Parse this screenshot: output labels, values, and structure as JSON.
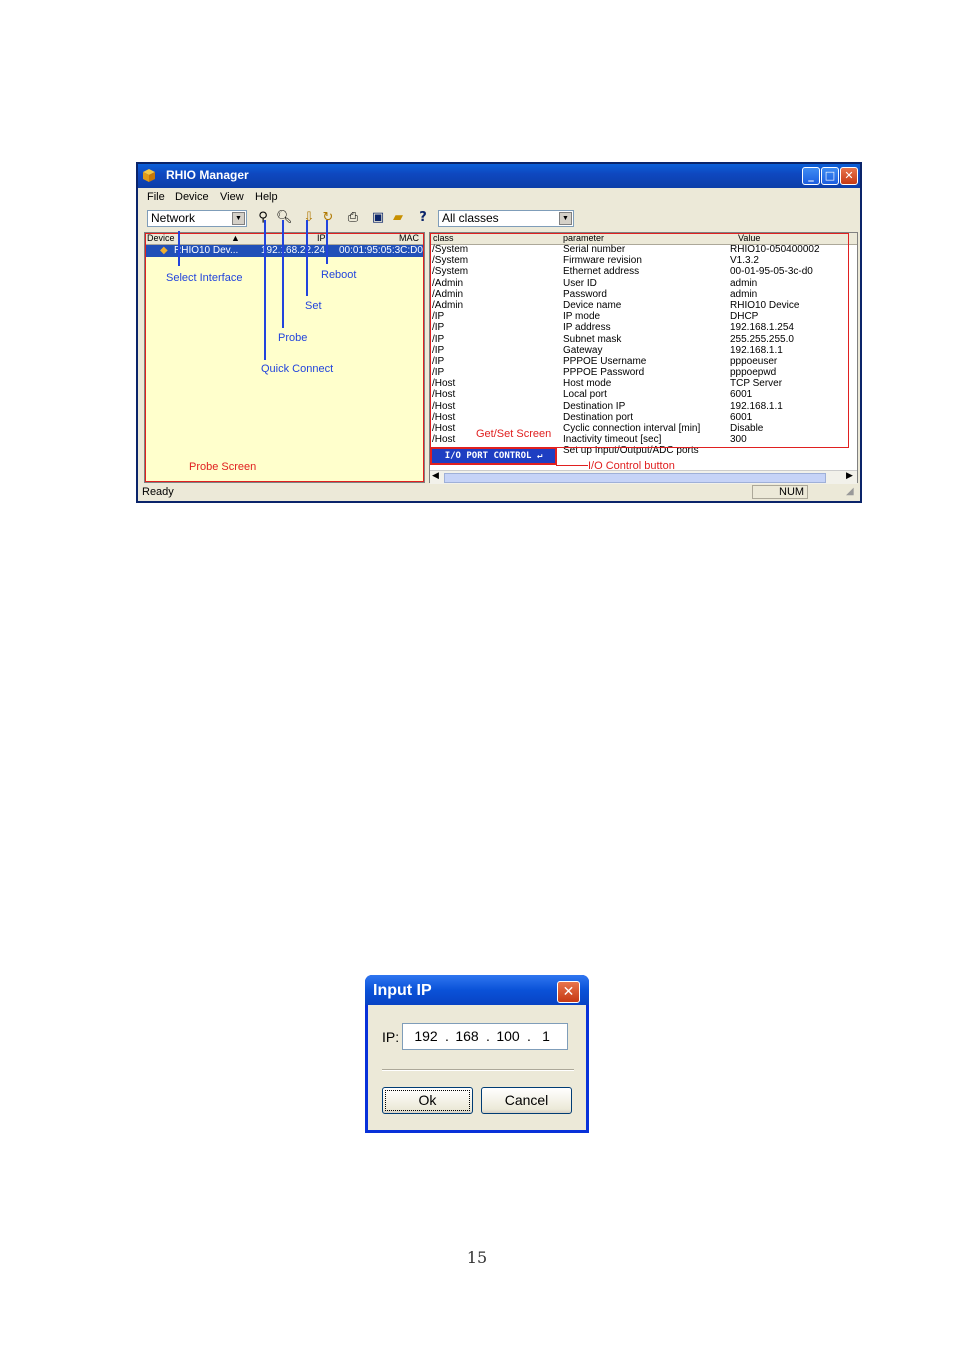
{
  "window": {
    "title": "RHIO Manager",
    "controls": {
      "minimize": "_",
      "maximize": "□",
      "close": "✕"
    }
  },
  "menu": [
    "File",
    "Device",
    "View",
    "Help"
  ],
  "toolbar": {
    "interface_value": "Network",
    "class_filter_value": "All classes",
    "icons": [
      "quick-connect-icon",
      "probe-icon",
      "set-icon",
      "reboot-icon",
      "print-icon",
      "save-icon",
      "open-icon",
      "help-icon"
    ]
  },
  "probe_pane": {
    "columns": [
      "Device",
      "IP",
      "MAC"
    ],
    "rows": [
      {
        "device": "RHIO10 Dev...",
        "ip": "192.168.22.24",
        "mac": "00:01:95:05:3C:D0"
      }
    ]
  },
  "getset_pane": {
    "columns": [
      "class",
      "parameter",
      "Value"
    ],
    "rows": [
      {
        "cls": "/System",
        "param": "Serial number",
        "value": "RHIO10-050400002"
      },
      {
        "cls": "/System",
        "param": "Firmware revision",
        "value": "V1.3.2"
      },
      {
        "cls": "/System",
        "param": "Ethernet address",
        "value": "00-01-95-05-3c-d0"
      },
      {
        "cls": "/Admin",
        "param": "User ID",
        "value": "admin"
      },
      {
        "cls": "/Admin",
        "param": "Password",
        "value": "admin"
      },
      {
        "cls": "/Admin",
        "param": "Device name",
        "value": "RHIO10 Device"
      },
      {
        "cls": "/IP",
        "param": "IP mode",
        "value": "DHCP"
      },
      {
        "cls": "/IP",
        "param": "IP address",
        "value": "192.168.1.254"
      },
      {
        "cls": "/IP",
        "param": "Subnet mask",
        "value": "255.255.255.0"
      },
      {
        "cls": "/IP",
        "param": "Gateway",
        "value": "192.168.1.1"
      },
      {
        "cls": "/IP",
        "param": "PPPOE Username",
        "value": "pppoeuser"
      },
      {
        "cls": "/IP",
        "param": "PPPOE Password",
        "value": "pppoepwd"
      },
      {
        "cls": "/Host",
        "param": "Host mode",
        "value": "TCP Server"
      },
      {
        "cls": "/Host",
        "param": "Local port",
        "value": "6001"
      },
      {
        "cls": "/Host",
        "param": "Destination IP",
        "value": "192.168.1.1"
      },
      {
        "cls": "/Host",
        "param": "Destination port",
        "value": "6001"
      },
      {
        "cls": "/Host",
        "param": "Cyclic connection interval [min]",
        "value": "Disable"
      },
      {
        "cls": "/Host",
        "param": "Inactivity timeout [sec]",
        "value": "300"
      },
      {
        "cls": "",
        "param": "Set up Input/Output/ADC ports",
        "value": ""
      }
    ],
    "io_button_label": "I/O PORT CONTROL ↵"
  },
  "statusbar": {
    "text": "Ready",
    "num": "NUM"
  },
  "annotations": {
    "select_interface": "Select Interface",
    "reboot": "Reboot",
    "set": "Set",
    "probe": "Probe",
    "quick_connect": "Quick Connect",
    "probe_screen": "Probe Screen",
    "getset_screen": "Get/Set Screen",
    "io_control_button": "I/O Control button"
  },
  "dialog": {
    "title": "Input IP",
    "close": "✕",
    "ip_label": "IP:",
    "octets": [
      "192",
      "168",
      "100",
      "1"
    ],
    "ok_label": "Ok",
    "cancel_label": "Cancel"
  },
  "page_number": "15"
}
